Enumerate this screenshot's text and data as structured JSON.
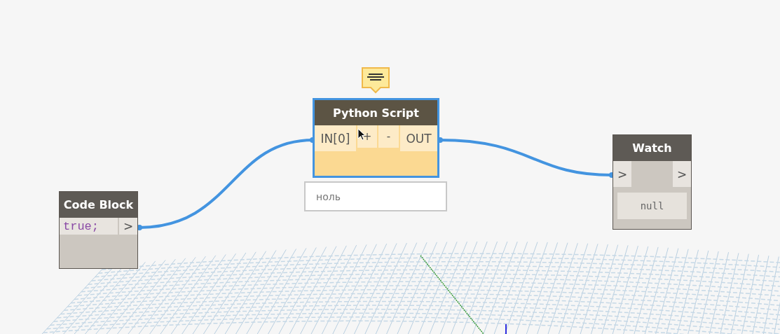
{
  "nodes": [
    {
      "kind": "code_block",
      "title": "Code Block",
      "code": "true;",
      "output": ">",
      "selected": false
    },
    {
      "kind": "python_script",
      "title": "Python Script",
      "input": "IN[0]",
      "add": "+",
      "remove": "-",
      "output": "OUT",
      "preview": "ноль",
      "selected": true
    },
    {
      "kind": "watch",
      "title": "Watch",
      "input": ">",
      "output": ">",
      "value": "null",
      "selected": false
    }
  ]
}
